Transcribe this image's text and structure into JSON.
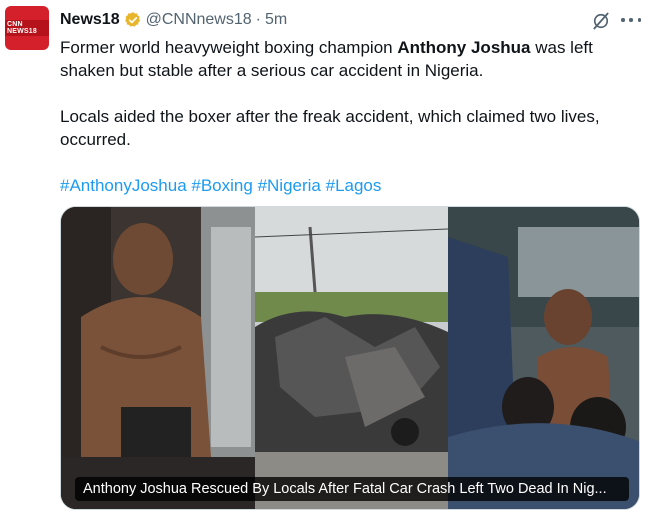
{
  "tweet": {
    "author_name": "News18",
    "handle": "@CNNnews18",
    "separator": "·",
    "time": "5m",
    "avatar_label": "CNN NEWS18",
    "text_p1_before": "Former world heavyweight boxing champion ",
    "text_p1_bold": "Anthony Joshua",
    "text_p1_after": " was left shaken but stable after a serious car accident in Nigeria.",
    "text_p2": "Locals aided the boxer after the freak accident, which claimed two lives, occurred.",
    "hashtags": [
      "#AnthonyJoshua",
      "#Boxing",
      "#Nigeria",
      "#Lagos"
    ],
    "media_caption": "Anthony Joshua Rescued By Locals After Fatal Car Crash Left Two Dead In Nig..."
  },
  "colors": {
    "link": "#1d9bf0",
    "verified": "#e8b62c",
    "secondary_text": "#536471",
    "brand_red": "#d3202a"
  },
  "icons": [
    "verified-badge-icon",
    "grok-icon",
    "more-icon"
  ]
}
